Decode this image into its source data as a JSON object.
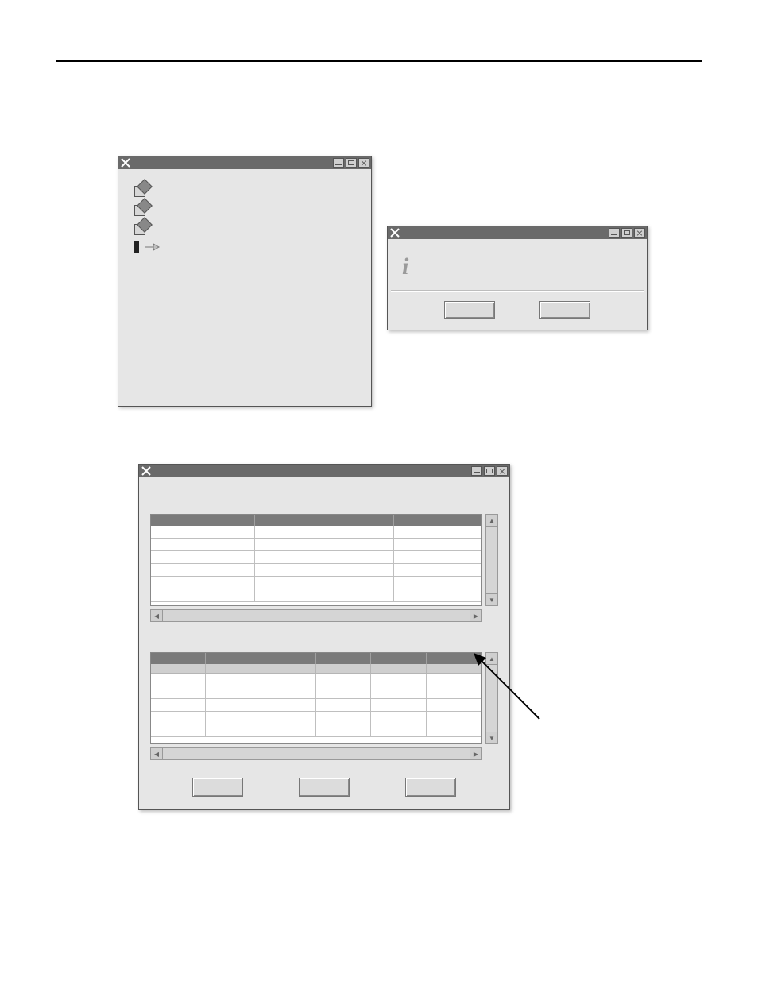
{
  "windows": {
    "tree_window": {
      "title": "",
      "items": [
        {
          "type": "checkbox-edit",
          "label": ""
        },
        {
          "type": "checkbox-edit",
          "label": ""
        },
        {
          "type": "checkbox-edit",
          "label": ""
        },
        {
          "type": "pointer",
          "label": ""
        }
      ]
    },
    "info_dialog": {
      "title": "",
      "message": "",
      "buttons": [
        {
          "label": ""
        },
        {
          "label": ""
        }
      ]
    },
    "table_window": {
      "title": "",
      "top_table": {
        "columns": [
          "",
          "",
          ""
        ],
        "rows": [
          [
            "",
            "",
            ""
          ],
          [
            "",
            "",
            ""
          ],
          [
            "",
            "",
            ""
          ],
          [
            "",
            "",
            ""
          ],
          [
            "",
            "",
            ""
          ],
          [
            "",
            "",
            ""
          ]
        ]
      },
      "bottom_table": {
        "columns": [
          "",
          "",
          "",
          "",
          "",
          ""
        ],
        "subcolumns": [
          "",
          "",
          "",
          "",
          "",
          ""
        ],
        "rows": [
          [
            "",
            "",
            "",
            "",
            "",
            ""
          ],
          [
            "",
            "",
            "",
            "",
            "",
            ""
          ],
          [
            "",
            "",
            "",
            "",
            "",
            ""
          ],
          [
            "",
            "",
            "",
            "",
            "",
            ""
          ],
          [
            "",
            "",
            "",
            "",
            "",
            ""
          ]
        ]
      },
      "buttons": [
        {
          "label": ""
        },
        {
          "label": ""
        },
        {
          "label": ""
        }
      ]
    }
  }
}
